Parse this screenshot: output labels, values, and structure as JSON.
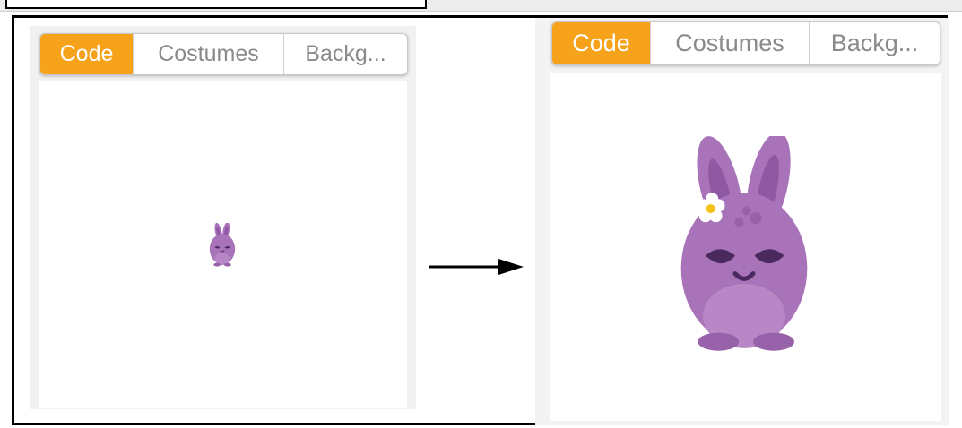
{
  "left_editor": {
    "tabs": [
      {
        "label": "Code",
        "active": true
      },
      {
        "label": "Costumes",
        "active": false
      },
      {
        "label": "Backg...",
        "active": false
      }
    ]
  },
  "right_editor": {
    "tabs": [
      {
        "label": "Code",
        "active": true
      },
      {
        "label": "Costumes",
        "active": false
      },
      {
        "label": "Backg...",
        "active": false
      }
    ]
  },
  "colors": {
    "active_tab": "#f7a21b",
    "bunny_body": "#a873b8",
    "bunny_ears_inner": "#8f58a3"
  },
  "icons": {
    "transition": "right-arrow-icon",
    "character": "purple-bunny-sprite"
  }
}
